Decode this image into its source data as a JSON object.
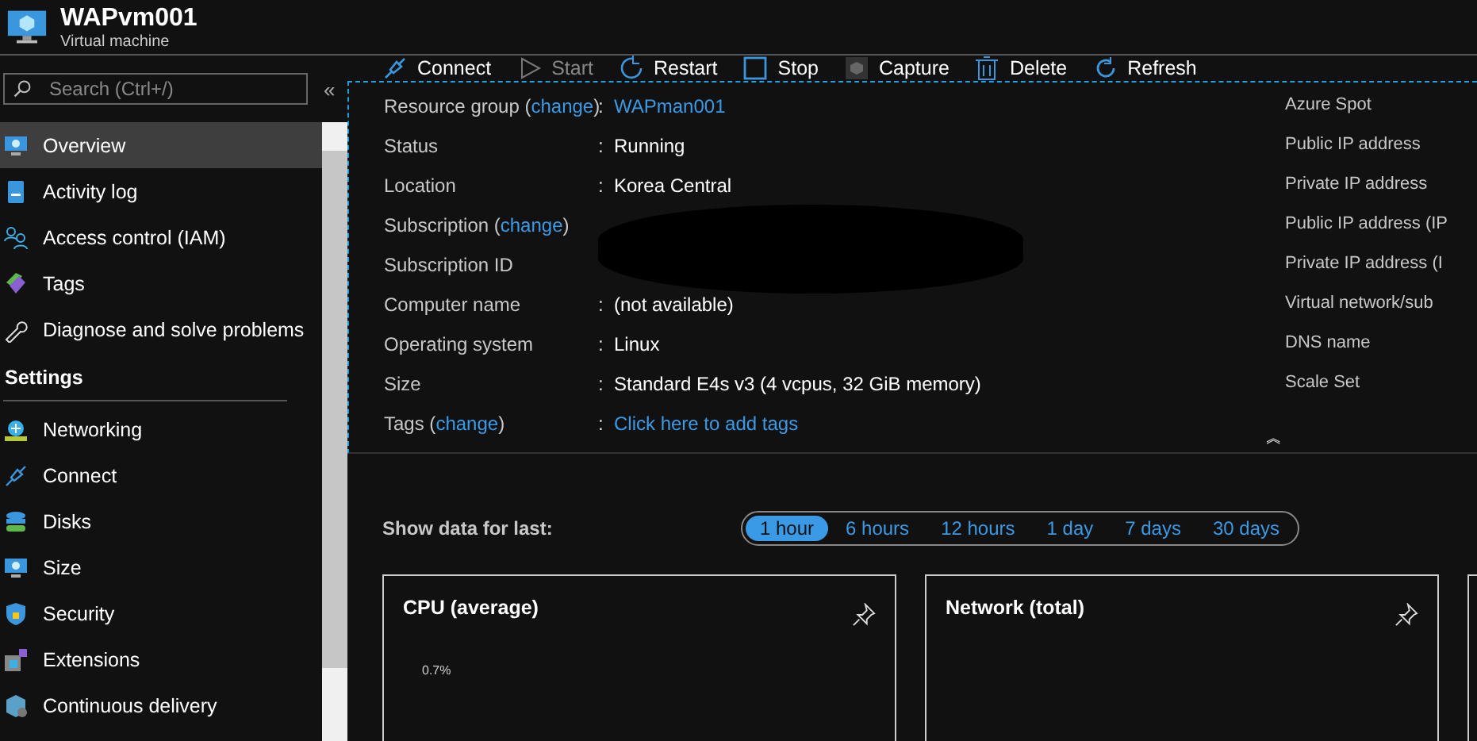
{
  "header": {
    "title": "WAPvm001",
    "subtitle": "Virtual machine"
  },
  "sidebar": {
    "search": {
      "placeholder": "Search (Ctrl+/)"
    },
    "collapse": "«",
    "items": [
      {
        "label": "Overview",
        "selected": true
      },
      {
        "label": "Activity log",
        "selected": false
      },
      {
        "label": "Access control (IAM)",
        "selected": false
      },
      {
        "label": "Tags",
        "selected": false
      },
      {
        "label": "Diagnose and solve problems",
        "selected": false
      }
    ],
    "section": "Settings",
    "settings_items": [
      {
        "label": "Networking",
        "selected": false
      },
      {
        "label": "Connect",
        "selected": false
      },
      {
        "label": "Disks",
        "selected": false
      },
      {
        "label": "Size",
        "selected": false
      },
      {
        "label": "Security",
        "selected": false
      },
      {
        "label": "Extensions",
        "selected": false
      },
      {
        "label": "Continuous delivery",
        "selected": false
      }
    ]
  },
  "toolbar": [
    {
      "label": "Connect",
      "disabled": false
    },
    {
      "label": "Start",
      "disabled": true
    },
    {
      "label": "Restart",
      "disabled": false
    },
    {
      "label": "Stop",
      "disabled": false
    },
    {
      "label": "Capture",
      "disabled": false
    },
    {
      "label": "Delete",
      "disabled": false
    },
    {
      "label": "Refresh",
      "disabled": false
    }
  ],
  "essentials": {
    "rows": [
      {
        "label": "Resource group (",
        "link": "change",
        "label_end": ")",
        "colon": ":",
        "value": "WAPman001",
        "value_is_link": true
      },
      {
        "label": "Status",
        "colon": ":",
        "value": "Running",
        "value_is_link": false
      },
      {
        "label": "Location",
        "colon": ":",
        "value": "Korea Central",
        "value_is_link": false
      },
      {
        "label": "Subscription (",
        "link": "change",
        "label_end": ")",
        "redacted": true
      },
      {
        "label": "Subscription ID",
        "redacted": true
      },
      {
        "label": "Computer name",
        "colon": ":",
        "value": "(not available)",
        "value_is_link": false
      },
      {
        "label": "Operating system",
        "colon": ":",
        "value": "Linux",
        "value_is_link": false
      },
      {
        "label": "Size",
        "colon": ":",
        "value": "Standard E4s v3 (4 vcpus, 32 GiB memory)",
        "value_is_link": false
      },
      {
        "label": "Tags (",
        "link": "change",
        "label_end": ")",
        "colon": ":",
        "value": "Click here to add tags",
        "value_is_link": true
      }
    ],
    "right_labels": [
      "Azure Spot",
      "Public IP address",
      "Private IP address",
      "Public IP address (IP",
      "Private IP address (I",
      "Virtual network/sub",
      "DNS name",
      "Scale Set"
    ],
    "collapse": "︽"
  },
  "time_range": {
    "label": "Show data for last:",
    "options": [
      {
        "label": "1 hour",
        "selected": true
      },
      {
        "label": "6 hours",
        "selected": false
      },
      {
        "label": "12 hours",
        "selected": false
      },
      {
        "label": "1 day",
        "selected": false
      },
      {
        "label": "7 days",
        "selected": false
      },
      {
        "label": "30 days",
        "selected": false
      }
    ]
  },
  "cards": [
    {
      "title": "CPU (average)",
      "axis_label": "0.7%"
    },
    {
      "title": "Network (total)"
    }
  ]
}
